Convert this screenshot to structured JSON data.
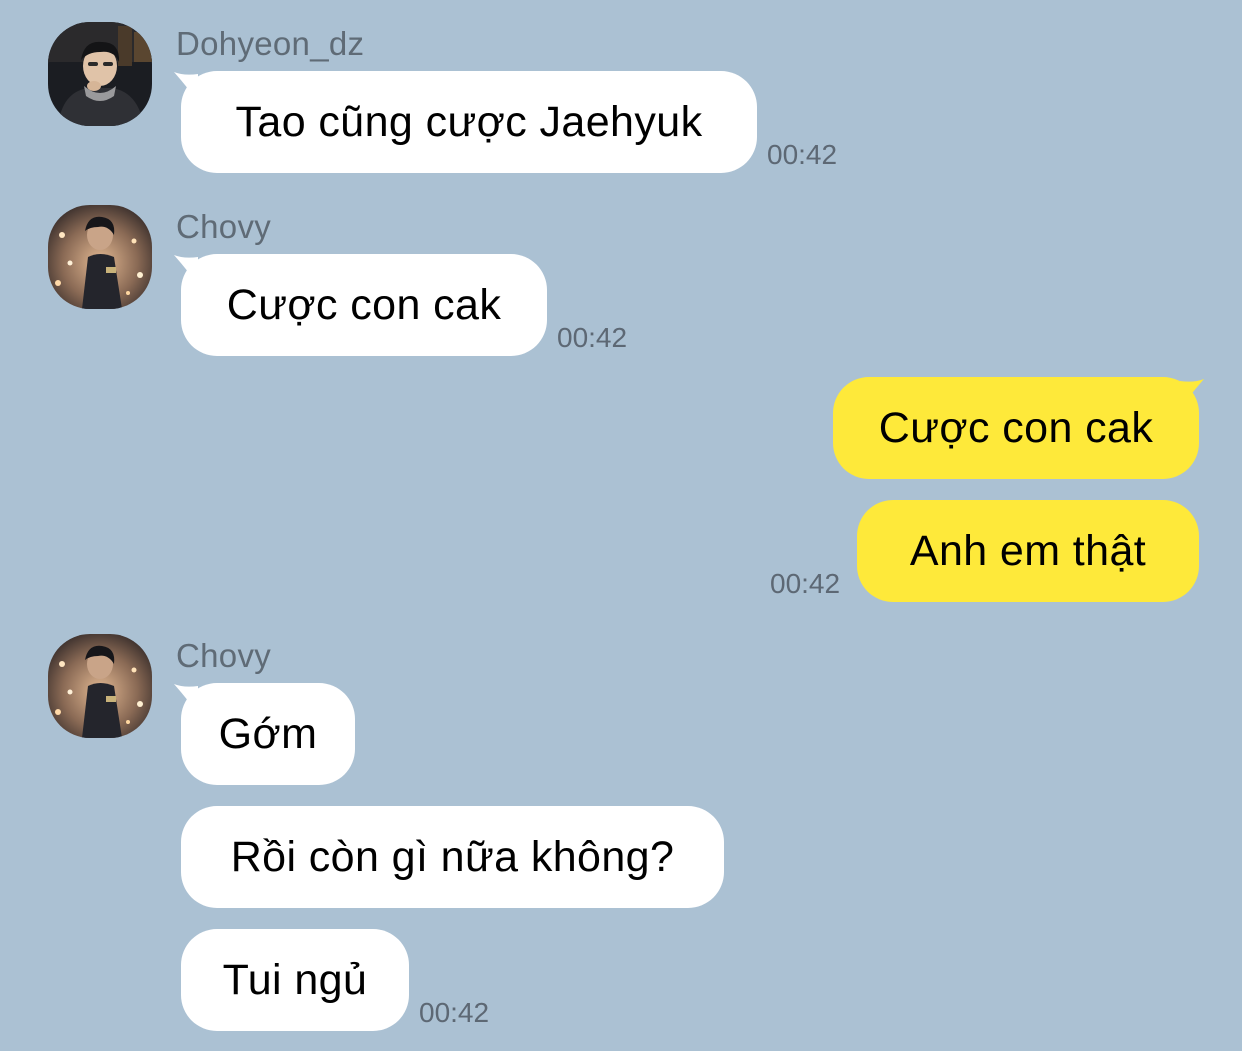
{
  "messages": [
    {
      "sender": "Dohyeon_dz",
      "text": "Tao cũng cược Jaehyuk",
      "time": "00:42"
    },
    {
      "sender": "Chovy",
      "text": "Cược con cak",
      "time": "00:42"
    },
    {
      "text": "Cược con cak"
    },
    {
      "text": "Anh em thật",
      "time": "00:42"
    },
    {
      "sender": "Chovy",
      "text": "Gớm"
    },
    {
      "text": "Rồi còn gì nữa không?"
    },
    {
      "text": "Tui ngủ",
      "time": "00:42"
    }
  ],
  "colors": {
    "background": "#abc1d3",
    "incoming_bubble": "#ffffff",
    "outgoing_bubble": "#fee93a",
    "sender_name": "#5f6b76",
    "timestamp": "#5d6874"
  },
  "icons": [
    "avatar-dohyeon-icon",
    "avatar-chovy-icon"
  ]
}
